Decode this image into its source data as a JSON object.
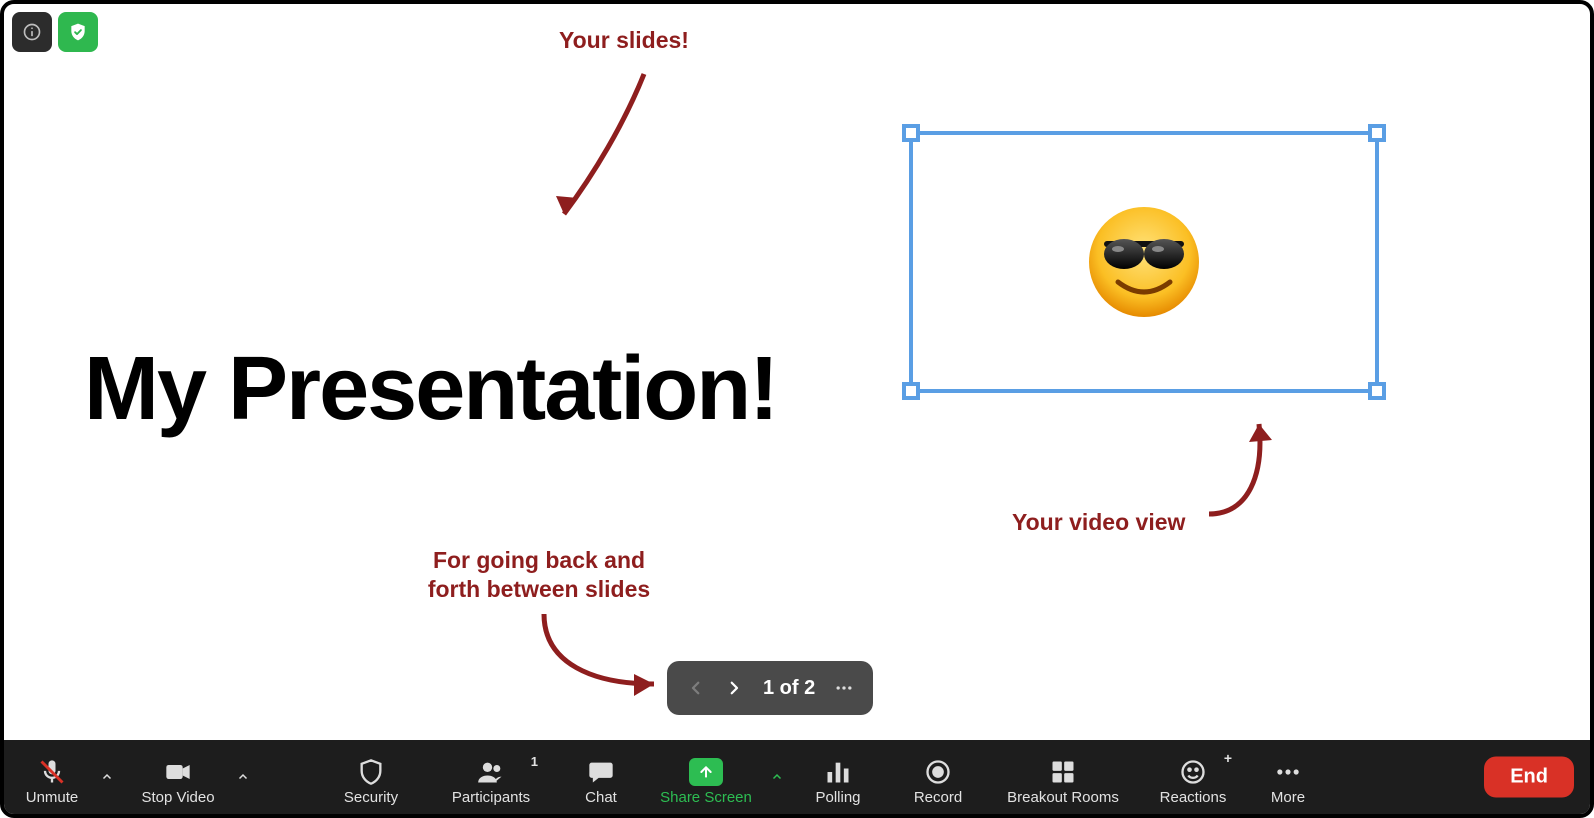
{
  "top_left": {
    "info_icon": "info",
    "shield_icon": "shield-check"
  },
  "annotations": {
    "slides_label": "Your slides!",
    "nav_hint_line1": "For going back and",
    "nav_hint_line2": "forth between slides",
    "video_hint": "Your video view"
  },
  "slide": {
    "title": "My Presentation!"
  },
  "video": {
    "emoji": "😎"
  },
  "slide_nav": {
    "page_text": "1 of 2",
    "prev_enabled": false,
    "next_enabled": true
  },
  "toolbar": {
    "unmute": "Unmute",
    "stop_video": "Stop Video",
    "security": "Security",
    "participants": "Participants",
    "participants_count": "1",
    "chat": "Chat",
    "share_screen": "Share Screen",
    "polling": "Polling",
    "record": "Record",
    "breakout_rooms": "Breakout Rooms",
    "reactions": "Reactions",
    "more": "More",
    "end": "End"
  },
  "colors": {
    "annotation": "#8e1e1e",
    "share_green": "#2dbd52",
    "end_red": "#d93126",
    "selection_blue": "#5a9ee4",
    "toolbar_bg": "#1d1d1d"
  }
}
